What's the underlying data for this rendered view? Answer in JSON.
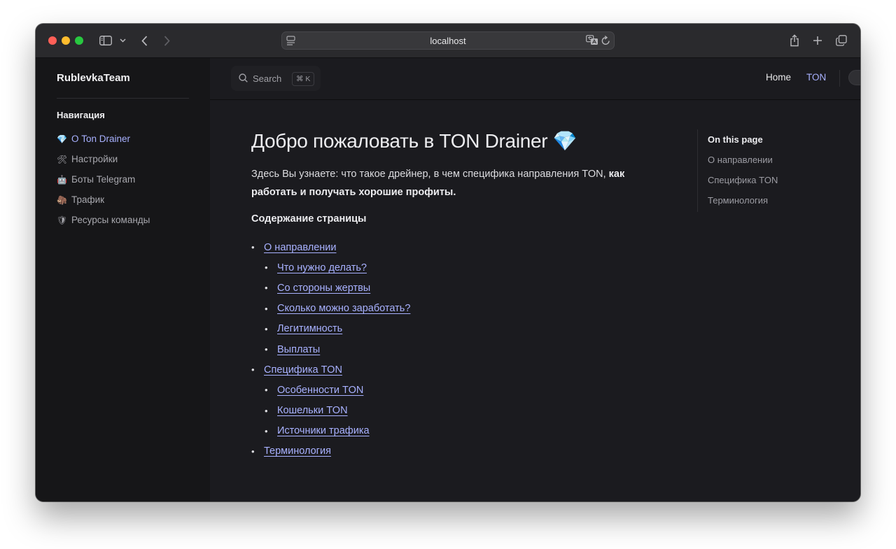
{
  "browser": {
    "url": "localhost"
  },
  "sidebar": {
    "brand": "RublevkaTeam",
    "heading": "Навигация",
    "items": [
      {
        "emoji": "💎",
        "label": "О Ton Drainer",
        "active": true
      },
      {
        "emoji": "🛠",
        "label": "Настройки"
      },
      {
        "emoji": "🤖",
        "label": "Боты Telegram"
      },
      {
        "emoji": "🦣",
        "label": "Трафик"
      },
      {
        "emoji": "🛡",
        "label": "Ресурсы команды"
      }
    ]
  },
  "topnav": {
    "search_label": "Search",
    "search_shortcut": "⌘ K",
    "links": [
      "Home",
      "TON"
    ]
  },
  "page": {
    "title": "Добро пожаловать в TON Drainer 💎",
    "intro_plain": "Здесь Вы узнаете: что такое дрейнер, в чем специфика направления TON, ",
    "intro_bold": "как работать и получать хорошие профиты.",
    "toc_heading": "Содержание страницы",
    "toc": [
      {
        "label": "О направлении",
        "level": 1
      },
      {
        "label": "Что нужно делать?",
        "level": 2
      },
      {
        "label": "Со стороны жертвы",
        "level": 2
      },
      {
        "label": "Сколько можно заработать?",
        "level": 2
      },
      {
        "label": "Легитимность",
        "level": 2
      },
      {
        "label": "Выплаты",
        "level": 2
      },
      {
        "label": "Специфика TON",
        "level": 1
      },
      {
        "label": "Особенности TON",
        "level": 2
      },
      {
        "label": "Кошельки TON",
        "level": 2
      },
      {
        "label": "Источники трафика",
        "level": 2
      },
      {
        "label": "Терминология",
        "level": 1
      }
    ]
  },
  "aside": {
    "title": "On this page",
    "links": [
      "О направлении",
      "Специфика TON",
      "Терминология"
    ]
  },
  "colors": {
    "accent": "#a8b1ff",
    "background": "#1b1b1f",
    "sidebar": "#161618"
  }
}
